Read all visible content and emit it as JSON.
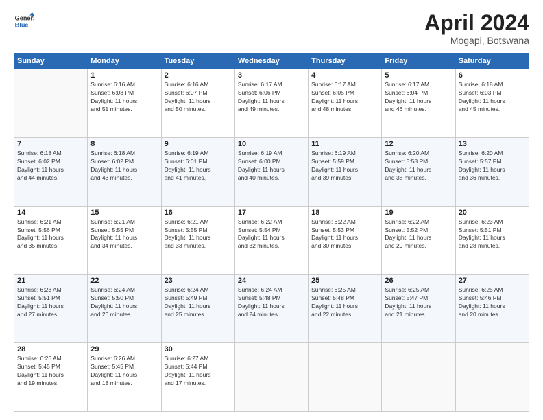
{
  "header": {
    "logo_line1": "General",
    "logo_line2": "Blue",
    "month_title": "April 2024",
    "location": "Mogapi, Botswana"
  },
  "days_of_week": [
    "Sunday",
    "Monday",
    "Tuesday",
    "Wednesday",
    "Thursday",
    "Friday",
    "Saturday"
  ],
  "weeks": [
    [
      {
        "day": "",
        "info": ""
      },
      {
        "day": "1",
        "info": "Sunrise: 6:16 AM\nSunset: 6:08 PM\nDaylight: 11 hours\nand 51 minutes."
      },
      {
        "day": "2",
        "info": "Sunrise: 6:16 AM\nSunset: 6:07 PM\nDaylight: 11 hours\nand 50 minutes."
      },
      {
        "day": "3",
        "info": "Sunrise: 6:17 AM\nSunset: 6:06 PM\nDaylight: 11 hours\nand 49 minutes."
      },
      {
        "day": "4",
        "info": "Sunrise: 6:17 AM\nSunset: 6:05 PM\nDaylight: 11 hours\nand 48 minutes."
      },
      {
        "day": "5",
        "info": "Sunrise: 6:17 AM\nSunset: 6:04 PM\nDaylight: 11 hours\nand 46 minutes."
      },
      {
        "day": "6",
        "info": "Sunrise: 6:18 AM\nSunset: 6:03 PM\nDaylight: 11 hours\nand 45 minutes."
      }
    ],
    [
      {
        "day": "7",
        "info": "Sunrise: 6:18 AM\nSunset: 6:02 PM\nDaylight: 11 hours\nand 44 minutes."
      },
      {
        "day": "8",
        "info": "Sunrise: 6:18 AM\nSunset: 6:02 PM\nDaylight: 11 hours\nand 43 minutes."
      },
      {
        "day": "9",
        "info": "Sunrise: 6:19 AM\nSunset: 6:01 PM\nDaylight: 11 hours\nand 41 minutes."
      },
      {
        "day": "10",
        "info": "Sunrise: 6:19 AM\nSunset: 6:00 PM\nDaylight: 11 hours\nand 40 minutes."
      },
      {
        "day": "11",
        "info": "Sunrise: 6:19 AM\nSunset: 5:59 PM\nDaylight: 11 hours\nand 39 minutes."
      },
      {
        "day": "12",
        "info": "Sunrise: 6:20 AM\nSunset: 5:58 PM\nDaylight: 11 hours\nand 38 minutes."
      },
      {
        "day": "13",
        "info": "Sunrise: 6:20 AM\nSunset: 5:57 PM\nDaylight: 11 hours\nand 36 minutes."
      }
    ],
    [
      {
        "day": "14",
        "info": "Sunrise: 6:21 AM\nSunset: 5:56 PM\nDaylight: 11 hours\nand 35 minutes."
      },
      {
        "day": "15",
        "info": "Sunrise: 6:21 AM\nSunset: 5:55 PM\nDaylight: 11 hours\nand 34 minutes."
      },
      {
        "day": "16",
        "info": "Sunrise: 6:21 AM\nSunset: 5:55 PM\nDaylight: 11 hours\nand 33 minutes."
      },
      {
        "day": "17",
        "info": "Sunrise: 6:22 AM\nSunset: 5:54 PM\nDaylight: 11 hours\nand 32 minutes."
      },
      {
        "day": "18",
        "info": "Sunrise: 6:22 AM\nSunset: 5:53 PM\nDaylight: 11 hours\nand 30 minutes."
      },
      {
        "day": "19",
        "info": "Sunrise: 6:22 AM\nSunset: 5:52 PM\nDaylight: 11 hours\nand 29 minutes."
      },
      {
        "day": "20",
        "info": "Sunrise: 6:23 AM\nSunset: 5:51 PM\nDaylight: 11 hours\nand 28 minutes."
      }
    ],
    [
      {
        "day": "21",
        "info": "Sunrise: 6:23 AM\nSunset: 5:51 PM\nDaylight: 11 hours\nand 27 minutes."
      },
      {
        "day": "22",
        "info": "Sunrise: 6:24 AM\nSunset: 5:50 PM\nDaylight: 11 hours\nand 26 minutes."
      },
      {
        "day": "23",
        "info": "Sunrise: 6:24 AM\nSunset: 5:49 PM\nDaylight: 11 hours\nand 25 minutes."
      },
      {
        "day": "24",
        "info": "Sunrise: 6:24 AM\nSunset: 5:48 PM\nDaylight: 11 hours\nand 24 minutes."
      },
      {
        "day": "25",
        "info": "Sunrise: 6:25 AM\nSunset: 5:48 PM\nDaylight: 11 hours\nand 22 minutes."
      },
      {
        "day": "26",
        "info": "Sunrise: 6:25 AM\nSunset: 5:47 PM\nDaylight: 11 hours\nand 21 minutes."
      },
      {
        "day": "27",
        "info": "Sunrise: 6:25 AM\nSunset: 5:46 PM\nDaylight: 11 hours\nand 20 minutes."
      }
    ],
    [
      {
        "day": "28",
        "info": "Sunrise: 6:26 AM\nSunset: 5:45 PM\nDaylight: 11 hours\nand 19 minutes."
      },
      {
        "day": "29",
        "info": "Sunrise: 6:26 AM\nSunset: 5:45 PM\nDaylight: 11 hours\nand 18 minutes."
      },
      {
        "day": "30",
        "info": "Sunrise: 6:27 AM\nSunset: 5:44 PM\nDaylight: 11 hours\nand 17 minutes."
      },
      {
        "day": "",
        "info": ""
      },
      {
        "day": "",
        "info": ""
      },
      {
        "day": "",
        "info": ""
      },
      {
        "day": "",
        "info": ""
      }
    ]
  ]
}
